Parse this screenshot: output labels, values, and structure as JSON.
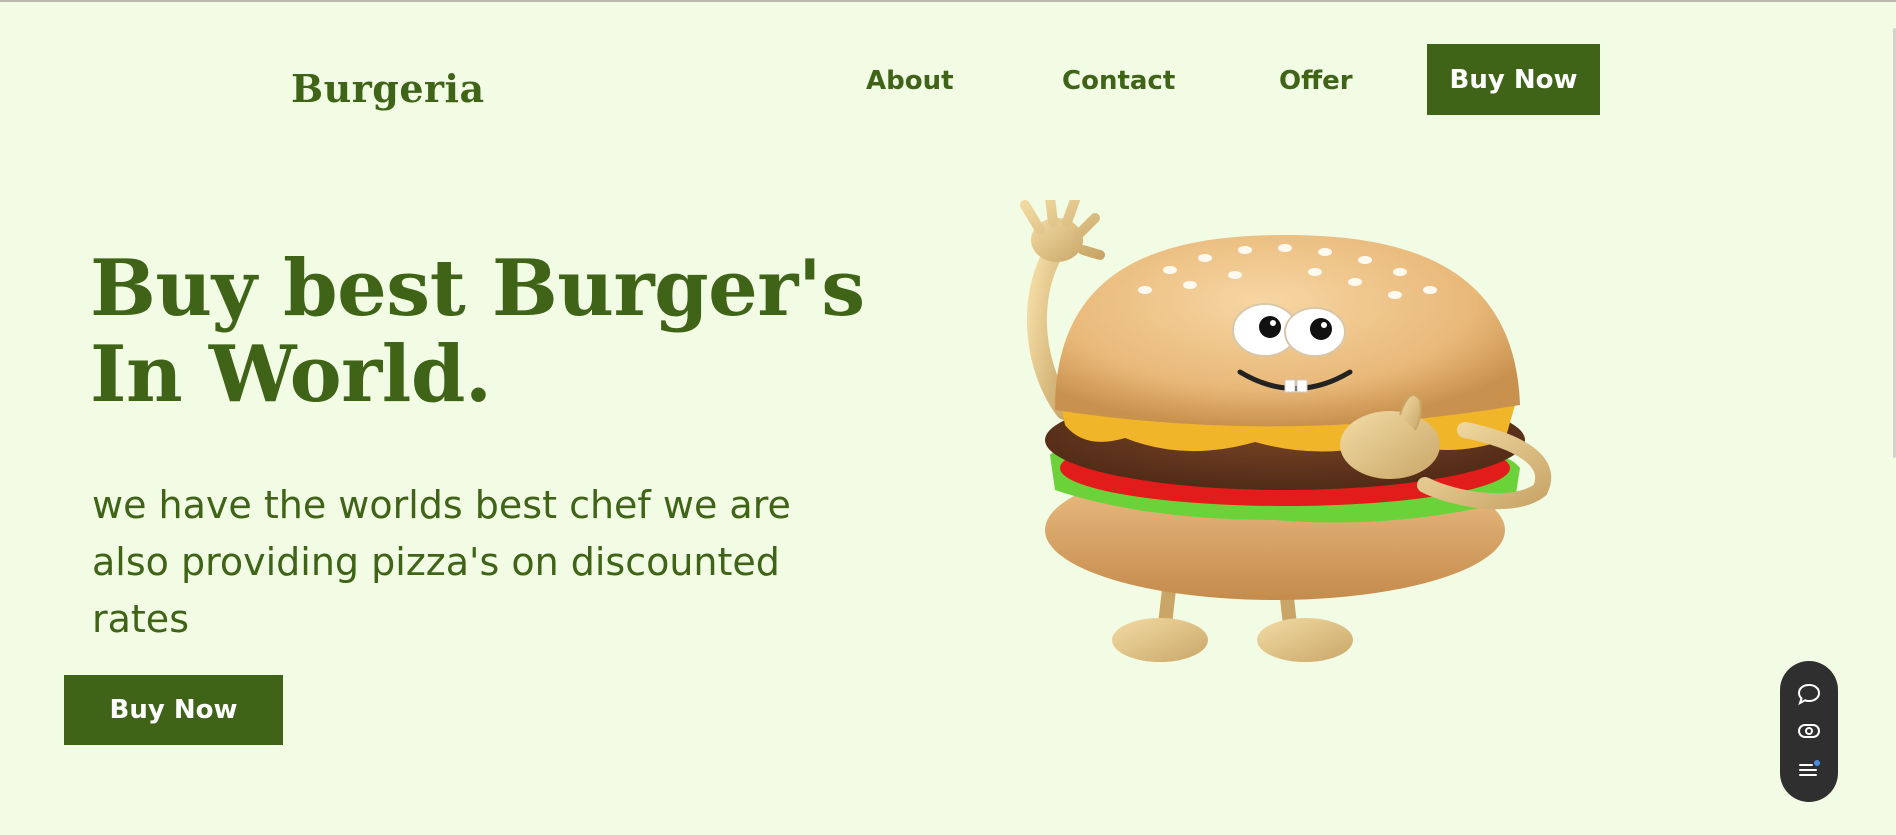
{
  "header": {
    "logo": "Burgeria",
    "nav": [
      "About",
      "Contact",
      "Offer"
    ],
    "cta_label": "Buy Now"
  },
  "hero": {
    "title_lines": [
      "Buy best Burger's",
      "In World."
    ],
    "subtitle": "we have the worlds best chef we are also providing pizza's on discounted rates",
    "cta_label": "Buy Now",
    "image": "cartoon-burger-mascot"
  },
  "floating_toolbar": {
    "icons": [
      "chat-icon",
      "eye-icon",
      "menu-notification-icon"
    ]
  },
  "colors": {
    "background": "#f2fbe3",
    "brand_green": "#3f6317",
    "button_text": "#ffffff",
    "toolbar": "#2f2f2f"
  }
}
